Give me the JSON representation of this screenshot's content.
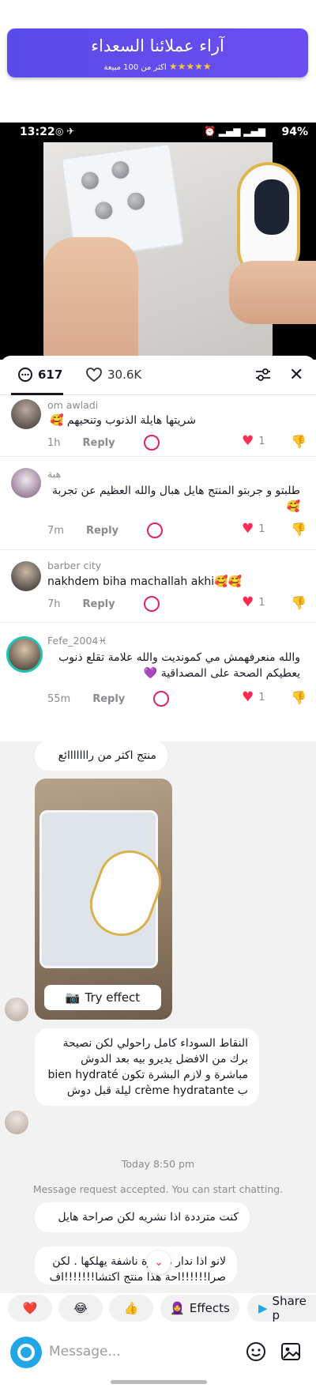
{
  "banner": {
    "title": "آراء عملائنا السعداء",
    "subtitle_prefix": "اكثر من 100 مبيعة",
    "stars": "★★★★★"
  },
  "statusbar": {
    "time": "13:22",
    "battery": "94%"
  },
  "comments_header": {
    "comment_count": "617",
    "like_count": "30.6K"
  },
  "comments": [
    {
      "name": "om awladi",
      "text": "شريتها هايلة الذنوب وتنحيهم 🥰",
      "time": "1h",
      "reply": "Reply",
      "likes": "1",
      "rtl": true
    },
    {
      "name": "هبة",
      "text": "طلبتو و جربتو المنتج هايل هبال والله العظيم عن تجربة 🥰",
      "time": "7m",
      "reply": "Reply",
      "likes": "1",
      "rtl": true
    },
    {
      "name": "barber city",
      "text": "nakhdem biha machallah akhi🥰🥰",
      "time": "7h",
      "reply": "Reply",
      "likes": "1",
      "rtl": false
    },
    {
      "name": "Fefe_2004♓",
      "text": "والله منعرفهمش مي كمونديت والله علامة تقلع ذنوب يعطيكم الصحة على المصداقية 💜",
      "time": "55m",
      "reply": "Reply",
      "likes": "1",
      "rtl": true
    }
  ],
  "chat": {
    "msg1": "منتج اكثر من رااااااائع",
    "try_effect": "Try effect",
    "msg2": "النقاط السوداء كامل راحولي لكن نصيحة برك من الافضل يديرو بيه بعد الدوش مباشرة و لازم البشرة تكون bien hydraté ب crème hydratante ليلة قبل دوش",
    "timestamp": "Today 8:50 pm",
    "system": "Message request accepted. You can start chatting.",
    "msg3": "كنت مترددة  اذا نشريه لكن صراحة هايل",
    "msg4": "لانو اذا ندار  ة شرة ناشفة يهلكها . لكن صرا!!!!!!احة هذا منتج اكتشا!!!!!!!اف"
  },
  "reactions": {
    "heart": "❤️",
    "laugh": "😂",
    "thumb": "👍",
    "effects": "Effects",
    "share": "Share p"
  },
  "input": {
    "placeholder": "Message..."
  }
}
